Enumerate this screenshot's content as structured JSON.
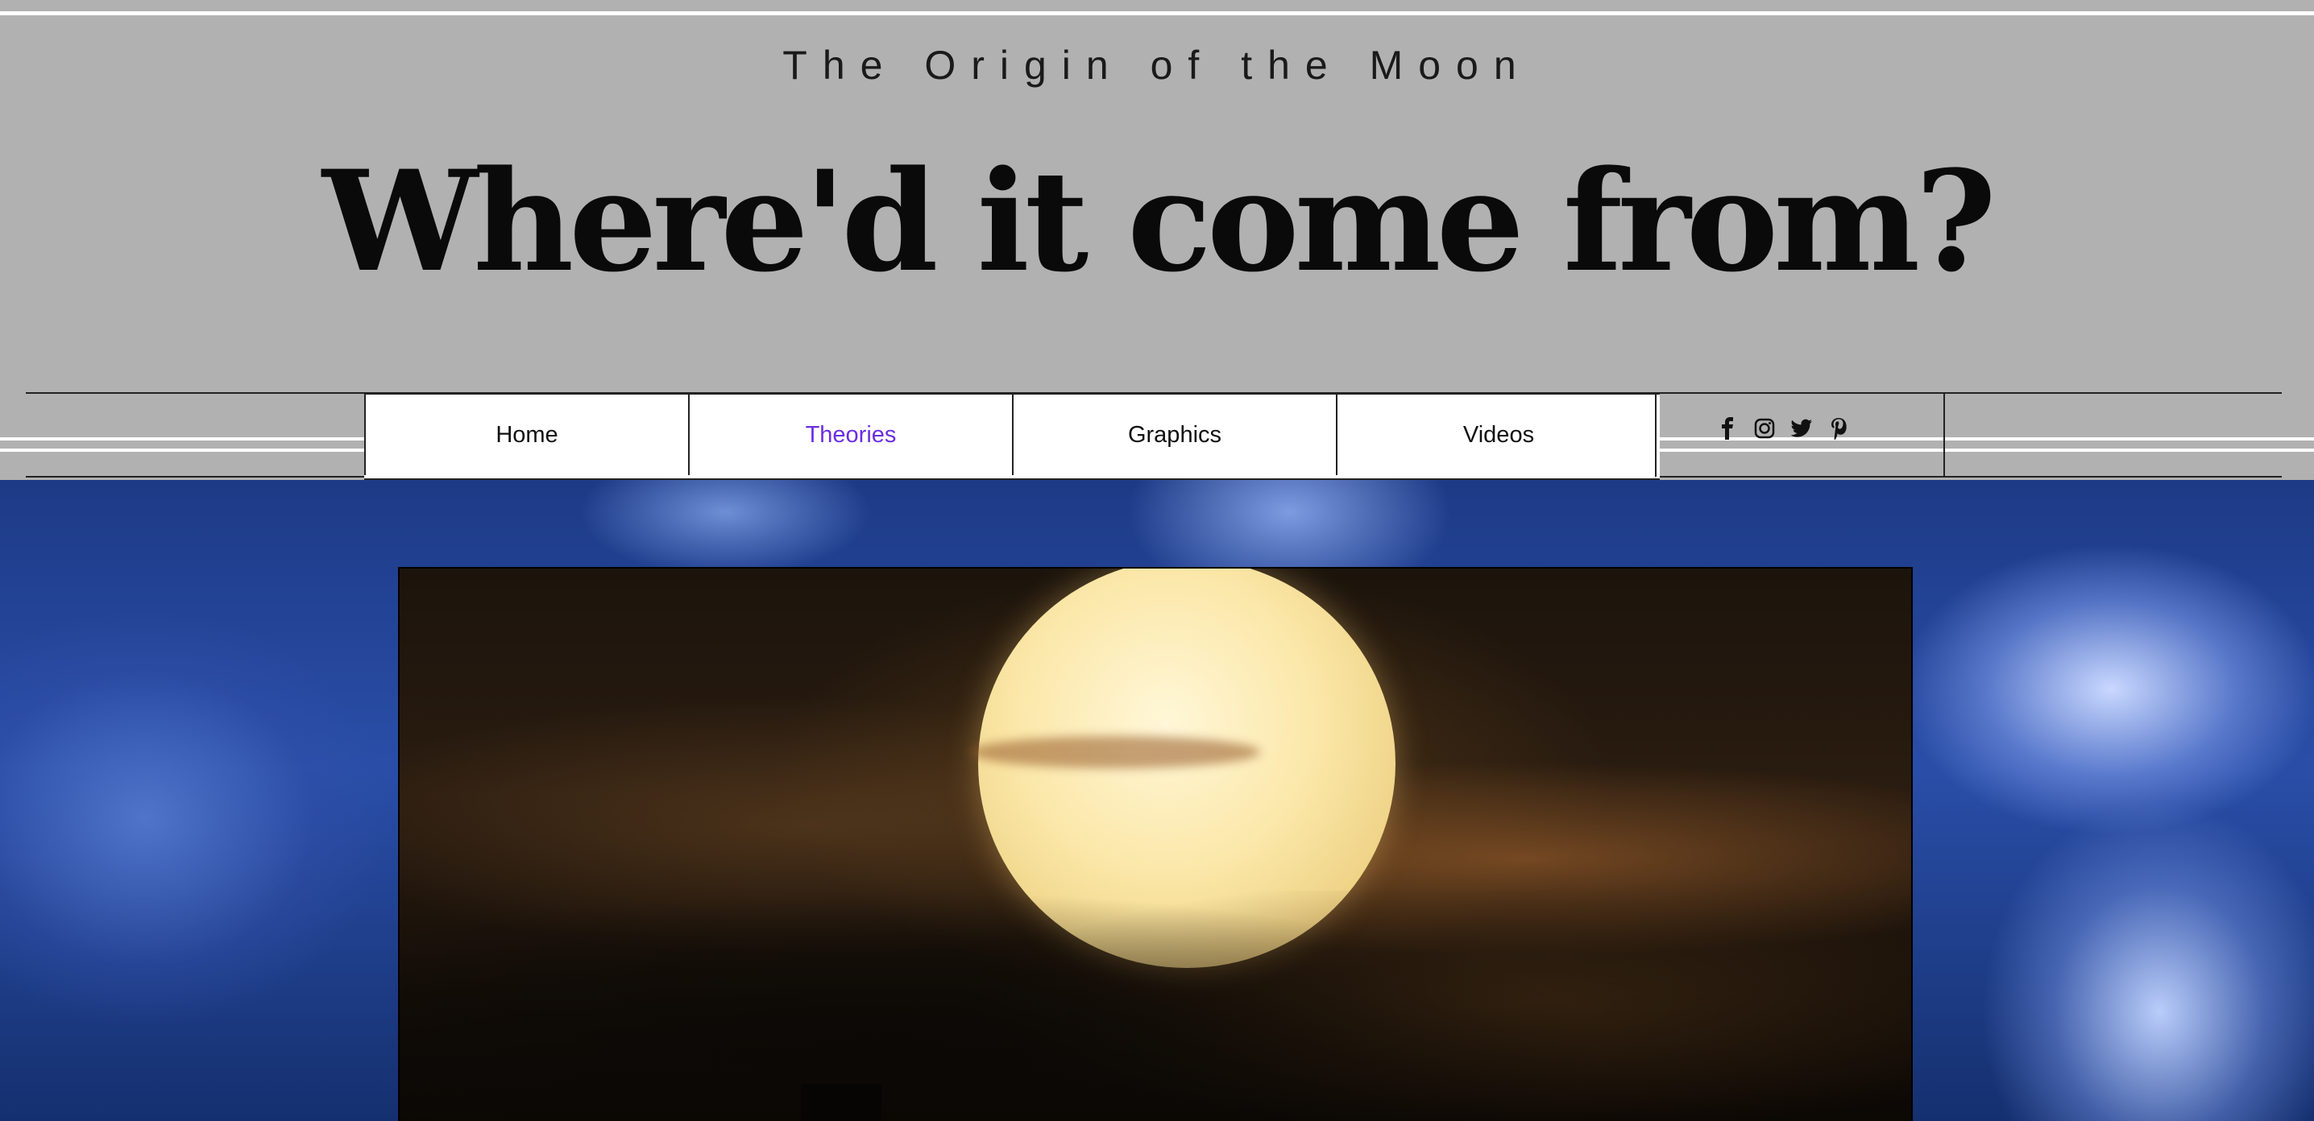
{
  "header": {
    "subtitle": "The Origin of the Moon",
    "headline": "Where'd it come from?"
  },
  "nav": {
    "items": [
      {
        "label": "Home",
        "active": false
      },
      {
        "label": "Theories",
        "active": true
      },
      {
        "label": "Graphics",
        "active": false
      },
      {
        "label": "Videos",
        "active": false
      }
    ],
    "active_color": "#6a2ee0"
  },
  "social": {
    "icons": [
      "facebook-icon",
      "instagram-icon",
      "twitter-icon",
      "pinterest-icon"
    ]
  },
  "colors": {
    "header_background": "#b1b1b1",
    "sky_blue": "#2a4ea8"
  }
}
